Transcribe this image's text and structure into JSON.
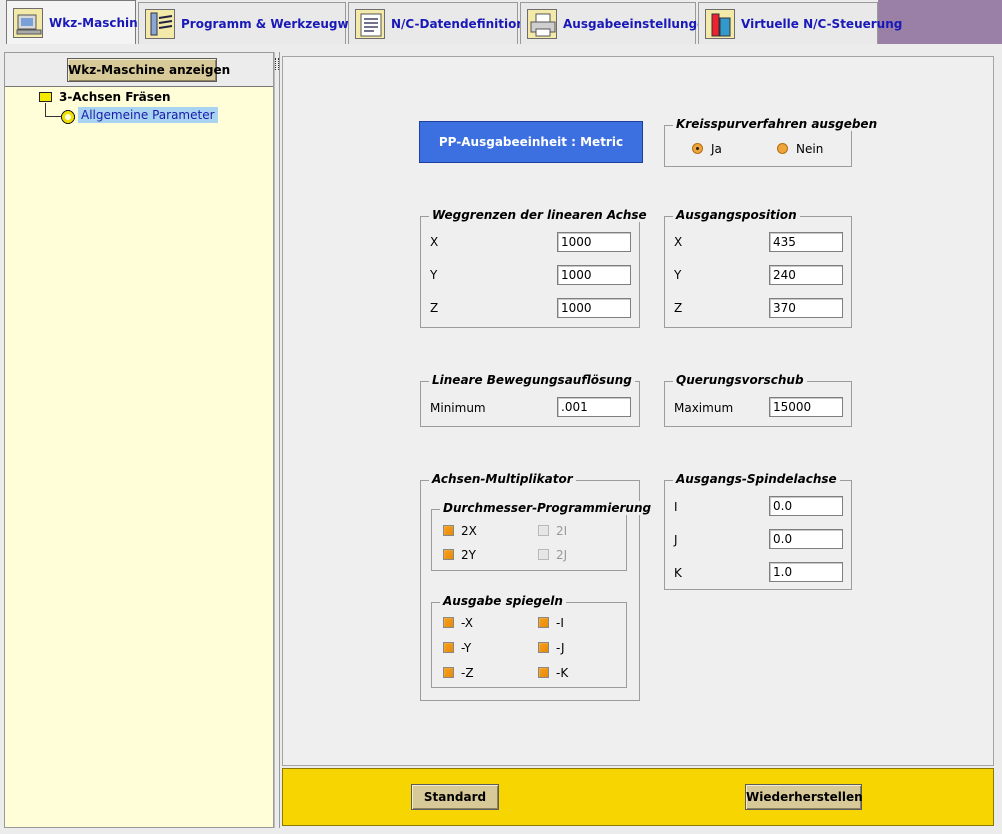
{
  "tabs": [
    {
      "label": "Wkz-Maschine",
      "active": true,
      "icon": "machine-icon"
    },
    {
      "label": "Programm & Werkzeugweg",
      "active": false,
      "icon": "toolpath-icon"
    },
    {
      "label": "N/C-Datendefinitionen",
      "active": false,
      "icon": "nc-data-icon"
    },
    {
      "label": "Ausgabeeinstellungen",
      "active": false,
      "icon": "printer-icon"
    },
    {
      "label": "Virtuelle N/C-Steuerung",
      "active": false,
      "icon": "virtual-controller-icon"
    }
  ],
  "left": {
    "show_button": "Wkz-Maschine anzeigen",
    "tree": {
      "root": "3-Achsen Fräsen",
      "child": "Allgemeine Parameter"
    }
  },
  "main": {
    "pp_unit": "PP-Ausgabeeinheit : Metric",
    "arc": {
      "title": "Kreisspurverfahren ausgeben",
      "yes": "Ja",
      "no": "Nein",
      "selected": "Ja"
    },
    "limits": {
      "title": "Weggrenzen der linearen Achse",
      "x_label": "X",
      "x": "1000",
      "y_label": "Y",
      "y": "1000",
      "z_label": "Z",
      "z": "1000"
    },
    "home": {
      "title": "Ausgangsposition",
      "x_label": "X",
      "x": "435",
      "y_label": "Y",
      "y": "240",
      "z_label": "Z",
      "z": "370"
    },
    "resolution": {
      "title": "Lineare Bewegungsauflösung",
      "label": "Minimum",
      "value": ".001"
    },
    "traverse": {
      "title": "Querungsvorschub",
      "label": "Maximum",
      "value": "15000"
    },
    "multiplier": {
      "title": "Achsen-Multiplikator",
      "diameter": {
        "title": "Durchmesser-Programmierung",
        "2x": "2X",
        "2i": "2I",
        "2y": "2Y",
        "2j": "2J"
      },
      "mirror": {
        "title": "Ausgabe spiegeln",
        "mx": "-X",
        "mi": "-I",
        "my": "-Y",
        "mj": "-J",
        "mz": "-Z",
        "mk": "-K"
      }
    },
    "spindle": {
      "title": "Ausgangs-Spindelachse",
      "i_label": "I",
      "i": "0.0",
      "j_label": "J",
      "j": "0.0",
      "k_label": "K",
      "k": "1.0"
    }
  },
  "footer": {
    "default_button": "Standard",
    "restore_button": "Wiederherstellen"
  },
  "colors": {
    "accent_tab_text": "#1919b8",
    "footer_bg": "#f7d500",
    "tree_bg": "#fffed8",
    "pp_unit_bg": "#3c6fe0",
    "tabbar_fill": "#9a7fa6"
  }
}
